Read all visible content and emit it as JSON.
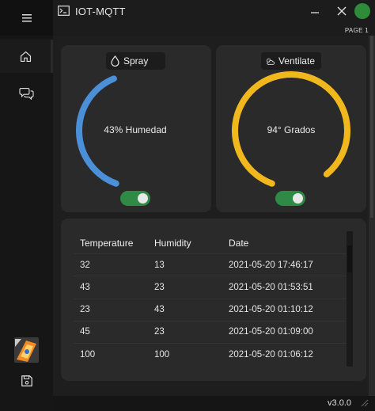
{
  "window": {
    "title": "IOT-MQTT",
    "page_label": "PAGE 1",
    "version": "v3.0.0",
    "status_color": "#2e8b3a"
  },
  "sidebar": {
    "items": [
      {
        "name": "menu",
        "icon": "hamburger-menu-icon"
      },
      {
        "name": "home",
        "icon": "home-icon"
      },
      {
        "name": "chat",
        "icon": "chat-bubbles-icon"
      },
      {
        "name": "logo",
        "icon": "app-logo-icon"
      },
      {
        "name": "save",
        "icon": "save-floppy-icon"
      }
    ]
  },
  "spray": {
    "label": "Spray",
    "icon": "water-drop-icon",
    "value_text": "43% Humedad",
    "level": 0.43,
    "color": "#4a8fd8",
    "toggle_on": true
  },
  "ventilate": {
    "label": "Ventilate",
    "icon": "cloud-sun-icon",
    "value_text": "94° Grados",
    "level": 0.94,
    "color": "#f0b81c",
    "toggle_on": true
  },
  "table": {
    "columns": [
      "Temperature",
      "Humidity",
      "Date"
    ],
    "rows": [
      [
        "32",
        "13",
        "2021-05-20 17:46:17"
      ],
      [
        "43",
        "23",
        "2021-05-20 01:53:51"
      ],
      [
        "23",
        "43",
        "2021-05-20 01:10:12"
      ],
      [
        "45",
        "23",
        "2021-05-20 01:09:00"
      ],
      [
        "100",
        "100",
        "2021-05-20 01:06:12"
      ]
    ]
  }
}
